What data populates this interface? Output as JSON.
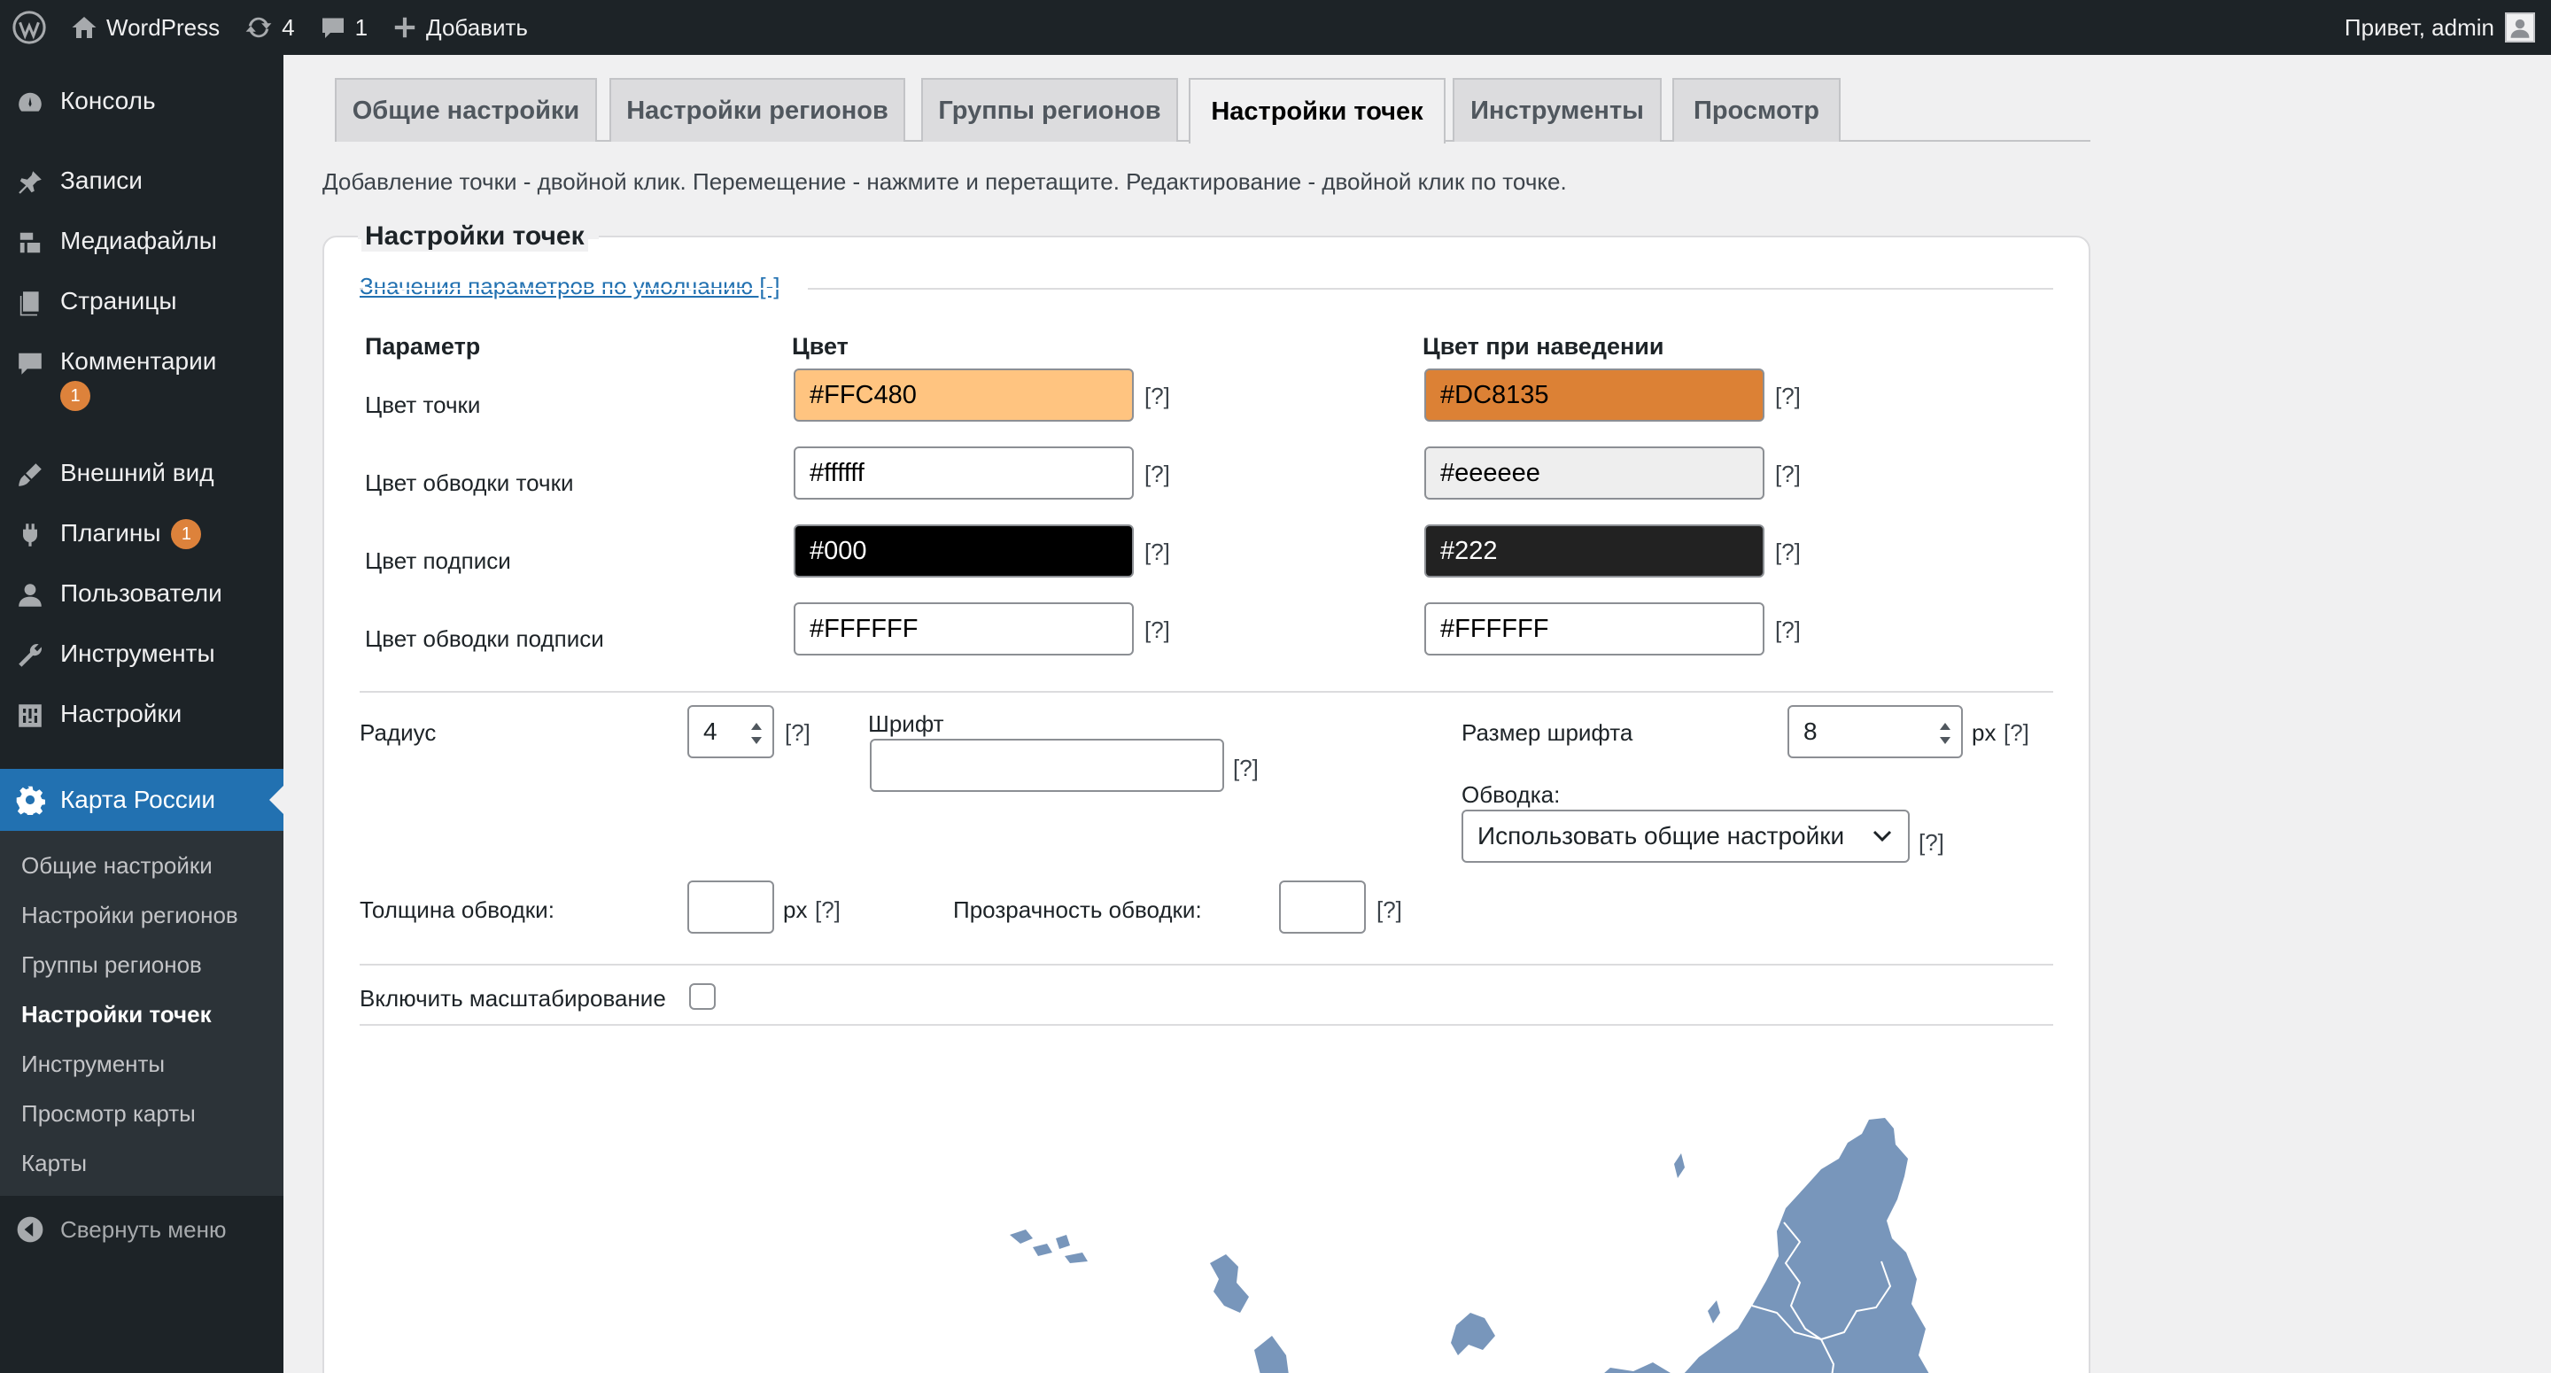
{
  "adminbar": {
    "site_name": "WordPress",
    "updates_count": "4",
    "comments_count": "1",
    "add_new": "Добавить",
    "greeting": "Привет, admin"
  },
  "sidebar": {
    "items": [
      {
        "label": "Консоль",
        "icon": "dashboard-icon"
      },
      {
        "label": "Записи",
        "icon": "pin-icon"
      },
      {
        "label": "Медиафайлы",
        "icon": "media-icon"
      },
      {
        "label": "Страницы",
        "icon": "pages-icon"
      },
      {
        "label": "Комментарии",
        "icon": "comments-icon",
        "badge": "1"
      },
      {
        "label": "Внешний вид",
        "icon": "brush-icon"
      },
      {
        "label": "Плагины",
        "icon": "plugin-icon",
        "badge": "1"
      },
      {
        "label": "Пользователи",
        "icon": "user-icon"
      },
      {
        "label": "Инструменты",
        "icon": "wrench-icon"
      },
      {
        "label": "Настройки",
        "icon": "settings-icon"
      }
    ],
    "active": {
      "label": "Карта России",
      "icon": "gear-icon"
    },
    "submenu": [
      "Общие настройки",
      "Настройки регионов",
      "Группы регионов",
      "Настройки точек",
      "Инструменты",
      "Просмотр карты",
      "Карты"
    ],
    "submenu_current_index": 3,
    "collapse": "Свернуть меню"
  },
  "tabs": [
    "Общие настройки",
    "Настройки регионов",
    "Группы регионов",
    "Настройки точек",
    "Инструменты",
    "Просмотр"
  ],
  "active_tab_index": 3,
  "hint": "Добавление точки - двойной клик. Перемещение - нажмите и перетащите. Редактирование - двойной клик по точке.",
  "panel": {
    "title": "Настройки точек",
    "defaults_link": "Значения параметров по умолчанию [-]",
    "headers": {
      "param": "Параметр",
      "color": "Цвет",
      "hover": "Цвет при наведении"
    },
    "rows": [
      {
        "label": "Цвет точки",
        "color": "#FFC480",
        "hover": "#DC8135",
        "color_bg": "#FFC480",
        "hover_bg": "#DC8135",
        "color_fg": "#000000",
        "hover_fg": "#000000"
      },
      {
        "label": "Цвет обводки точки",
        "color": "#ffffff",
        "hover": "#eeeeee",
        "color_bg": "#ffffff",
        "hover_bg": "#eeeeee",
        "color_fg": "#000000",
        "hover_fg": "#000000"
      },
      {
        "label": "Цвет подписи",
        "color": "#000",
        "hover": "#222",
        "color_bg": "#000000",
        "hover_bg": "#222222",
        "color_fg": "#ffffff",
        "hover_fg": "#ffffff"
      },
      {
        "label": "Цвет обводки подписи",
        "color": "#FFFFFF",
        "hover": "#FFFFFF",
        "color_bg": "#ffffff",
        "hover_bg": "#ffffff",
        "color_fg": "#000000",
        "hover_fg": "#000000"
      }
    ],
    "help": "[?]",
    "radius_label": "Радиус",
    "radius_value": "4",
    "font_label": "Шрифт",
    "font_value": "",
    "font_size_label": "Размер шрифта",
    "font_size_value": "8",
    "px": "px",
    "stroke_label": "Обводка:",
    "stroke_value": "Использовать общие настройки",
    "stroke_width_label": "Толщина обводки:",
    "stroke_width_value": "",
    "stroke_opacity_label": "Прозрачность обводки:",
    "stroke_opacity_value": "",
    "zoom_label": "Включить масштабирование",
    "zoom_checked": false,
    "map_color": "#7896bb"
  }
}
